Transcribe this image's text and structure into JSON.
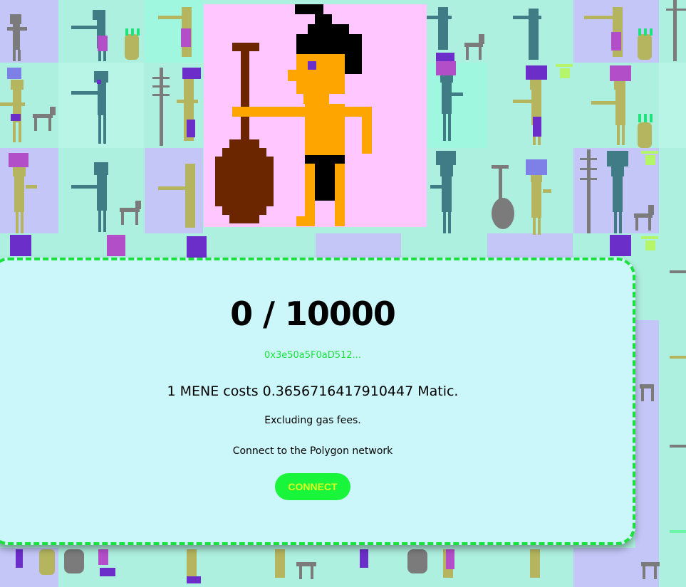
{
  "counter": {
    "text": "0 / 10000"
  },
  "contract": {
    "address_short": "0x3e50a5F0aD512..."
  },
  "pricing": {
    "price_text": "1 MENE costs 0.3656716417910447 Matic.",
    "gas_note": "Excluding gas fees."
  },
  "network": {
    "instruction": "Connect to the Polygon network"
  },
  "actions": {
    "connect_label": "CONNECT"
  },
  "colors": {
    "background": "#aef0df",
    "card_background": "#ccf7fa",
    "accent_green": "#19e23d",
    "button_text": "#dfff1f",
    "hero_background": "#ffc6ff"
  }
}
